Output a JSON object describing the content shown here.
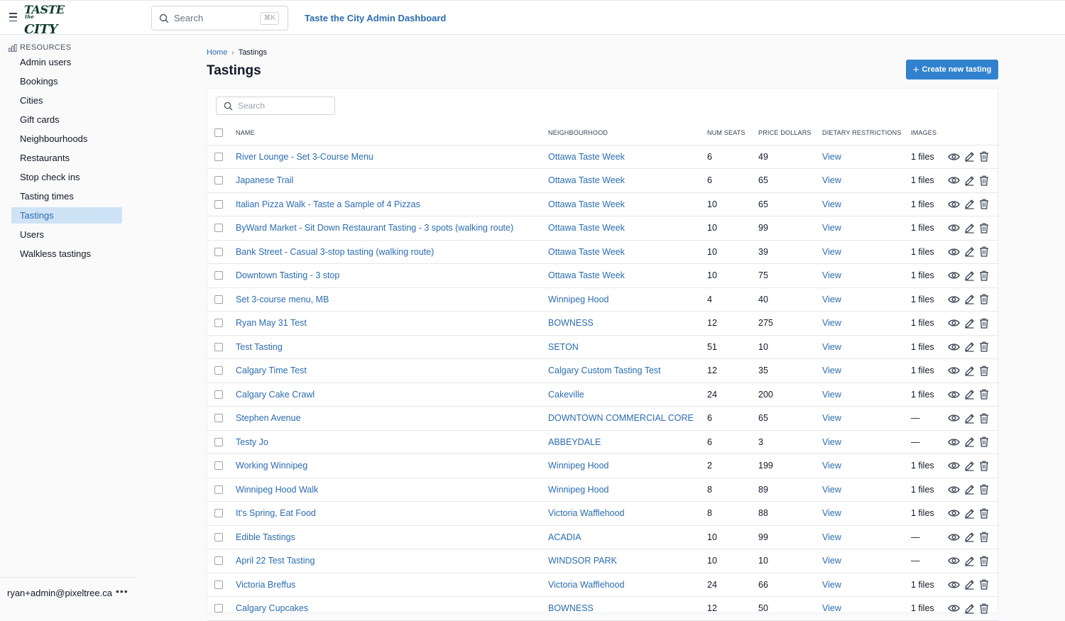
{
  "header": {
    "logo_line1": "TASTE",
    "logo_line2": "the",
    "logo_line3": "CITY",
    "search_placeholder": "Search",
    "search_shortcut": "⌘K",
    "app_title": "Taste the City Admin Dashboard"
  },
  "sidebar": {
    "section_label": "RESOURCES",
    "items": [
      {
        "label": "Admin users"
      },
      {
        "label": "Bookings"
      },
      {
        "label": "Cities"
      },
      {
        "label": "Gift cards"
      },
      {
        "label": "Neighbourhoods"
      },
      {
        "label": "Restaurants"
      },
      {
        "label": "Stop check ins"
      },
      {
        "label": "Tasting times"
      },
      {
        "label": "Tastings",
        "active": true
      },
      {
        "label": "Users"
      },
      {
        "label": "Walkless tastings"
      }
    ],
    "user_email": "ryan+admin@pixeltree.ca",
    "menu_icon": "more-dots-icon"
  },
  "breadcrumb": {
    "home": "Home",
    "current": "Tastings"
  },
  "page": {
    "title": "Tastings",
    "create_label": "Create new tasting"
  },
  "table": {
    "search_placeholder": "Search",
    "columns": [
      "NAME",
      "NEIGHBOURHOOD",
      "NUM SEATS",
      "PRICE DOLLARS",
      "DIETARY RESTRICTIONS",
      "IMAGES"
    ],
    "rows": [
      {
        "name": "River Lounge - Set 3-Course Menu",
        "neighbourhood": "Ottawa Taste Week",
        "seats": "6",
        "price": "49",
        "dietary": "View",
        "images": "1 files"
      },
      {
        "name": "Japanese Trail",
        "neighbourhood": "Ottawa Taste Week",
        "seats": "6",
        "price": "65",
        "dietary": "View",
        "images": "1 files"
      },
      {
        "name": "Italian Pizza Walk - Taste a Sample of 4 Pizzas",
        "neighbourhood": "Ottawa Taste Week",
        "seats": "10",
        "price": "65",
        "dietary": "View",
        "images": "1 files"
      },
      {
        "name": "ByWard Market - Sit Down Restaurant Tasting - 3 spots (walking route)",
        "neighbourhood": "Ottawa Taste Week",
        "seats": "10",
        "price": "99",
        "dietary": "View",
        "images": "1 files"
      },
      {
        "name": "Bank Street - Casual 3-stop tasting (walking route)",
        "neighbourhood": "Ottawa Taste Week",
        "seats": "10",
        "price": "39",
        "dietary": "View",
        "images": "1 files"
      },
      {
        "name": "Downtown Tasting - 3 stop",
        "neighbourhood": "Ottawa Taste Week",
        "seats": "10",
        "price": "75",
        "dietary": "View",
        "images": "1 files"
      },
      {
        "name": "Set 3-course menu, MB",
        "neighbourhood": "Winnipeg Hood",
        "seats": "4",
        "price": "40",
        "dietary": "View",
        "images": "1 files"
      },
      {
        "name": "Ryan May 31 Test",
        "neighbourhood": "BOWNESS",
        "seats": "12",
        "price": "275",
        "dietary": "View",
        "images": "1 files"
      },
      {
        "name": "Test Tasting",
        "neighbourhood": "SETON",
        "seats": "51",
        "price": "10",
        "dietary": "View",
        "images": "1 files"
      },
      {
        "name": "Calgary Time Test",
        "neighbourhood": "Calgary Custom Tasting Test",
        "seats": "12",
        "price": "35",
        "dietary": "View",
        "images": "1 files"
      },
      {
        "name": "Calgary Cake Crawl",
        "neighbourhood": "Cakeville",
        "seats": "24",
        "price": "200",
        "dietary": "View",
        "images": "1 files"
      },
      {
        "name": "Stephen Avenue",
        "neighbourhood": "DOWNTOWN COMMERCIAL CORE",
        "seats": "6",
        "price": "65",
        "dietary": "View",
        "images": "—"
      },
      {
        "name": "Testy Jo",
        "neighbourhood": "ABBEYDALE",
        "seats": "6",
        "price": "3",
        "dietary": "View",
        "images": "—"
      },
      {
        "name": "Working Winnipeg",
        "neighbourhood": "Winnipeg Hood",
        "seats": "2",
        "price": "199",
        "dietary": "View",
        "images": "1 files"
      },
      {
        "name": "Winnipeg Hood Walk",
        "neighbourhood": "Winnipeg Hood",
        "seats": "8",
        "price": "89",
        "dietary": "View",
        "images": "1 files"
      },
      {
        "name": "It's Spring, Eat Food",
        "neighbourhood": "Victoria Wafflehood",
        "seats": "8",
        "price": "88",
        "dietary": "View",
        "images": "1 files"
      },
      {
        "name": "Edible Tastings",
        "neighbourhood": "ACADIA",
        "seats": "10",
        "price": "99",
        "dietary": "View",
        "images": "—"
      },
      {
        "name": "April 22 Test Tasting",
        "neighbourhood": "WINDSOR PARK",
        "seats": "10",
        "price": "10",
        "dietary": "View",
        "images": "—"
      },
      {
        "name": "Victoria Breffus",
        "neighbourhood": "Victoria Wafflehood",
        "seats": "24",
        "price": "66",
        "dietary": "View",
        "images": "1 files"
      },
      {
        "name": "Calgary Cupcakes",
        "neighbourhood": "BOWNESS",
        "seats": "12",
        "price": "50",
        "dietary": "View",
        "images": "1 files"
      }
    ]
  },
  "colors": {
    "accent": "#3182ce",
    "link": "#2b6cb0",
    "active_bg": "#cfe3f7"
  }
}
